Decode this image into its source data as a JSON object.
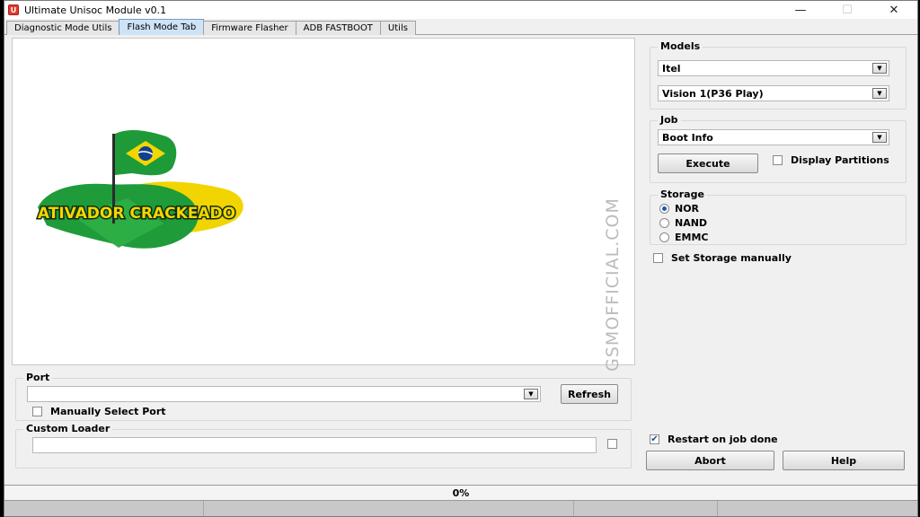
{
  "window": {
    "title": "Ultimate Unisoc Module v0.1",
    "icon_text": "U"
  },
  "tabs": [
    {
      "label": "Diagnostic Mode Utils",
      "active": false
    },
    {
      "label": "Flash Mode Tab",
      "active": true
    },
    {
      "label": "Firmware Flasher",
      "active": false
    },
    {
      "label": "ADB FASTBOOT",
      "active": false
    },
    {
      "label": "Utils",
      "active": false
    }
  ],
  "canvas": {
    "watermark": "GSMOFFICIAL.COM",
    "logo_text": "ATIVADOR CRACKEADO"
  },
  "models": {
    "label": "Models",
    "brand": "Itel",
    "model": "Vision 1(P36 Play)"
  },
  "job": {
    "label": "Job",
    "selected": "Boot Info",
    "execute_label": "Execute",
    "display_partitions_label": "Display Partitions",
    "display_partitions_checked": false
  },
  "storage": {
    "label": "Storage",
    "options": [
      {
        "label": "NOR",
        "selected": true
      },
      {
        "label": "NAND",
        "selected": false
      },
      {
        "label": "EMMC",
        "selected": false
      }
    ],
    "set_manually_label": "Set Storage manually",
    "set_manually_checked": false
  },
  "port": {
    "label": "Port",
    "value": "",
    "refresh_label": "Refresh",
    "manual_label": "Manually Select Port",
    "manual_checked": false
  },
  "loader": {
    "label": "Custom Loader",
    "value": ""
  },
  "actions": {
    "restart_label": "Restart on job done",
    "restart_checked": true,
    "abort_label": "Abort",
    "help_label": "Help"
  },
  "progress": {
    "text": "0%",
    "value": 0
  },
  "colors": {
    "accent": "#1a5ab4",
    "tab_active": "#cfe3f7",
    "app_icon": "#e23b2e"
  },
  "icons": {
    "close": "close-icon",
    "minimize": "minimize-icon",
    "maximize": "maximize-icon",
    "dropdown": "chevron-down-icon"
  }
}
